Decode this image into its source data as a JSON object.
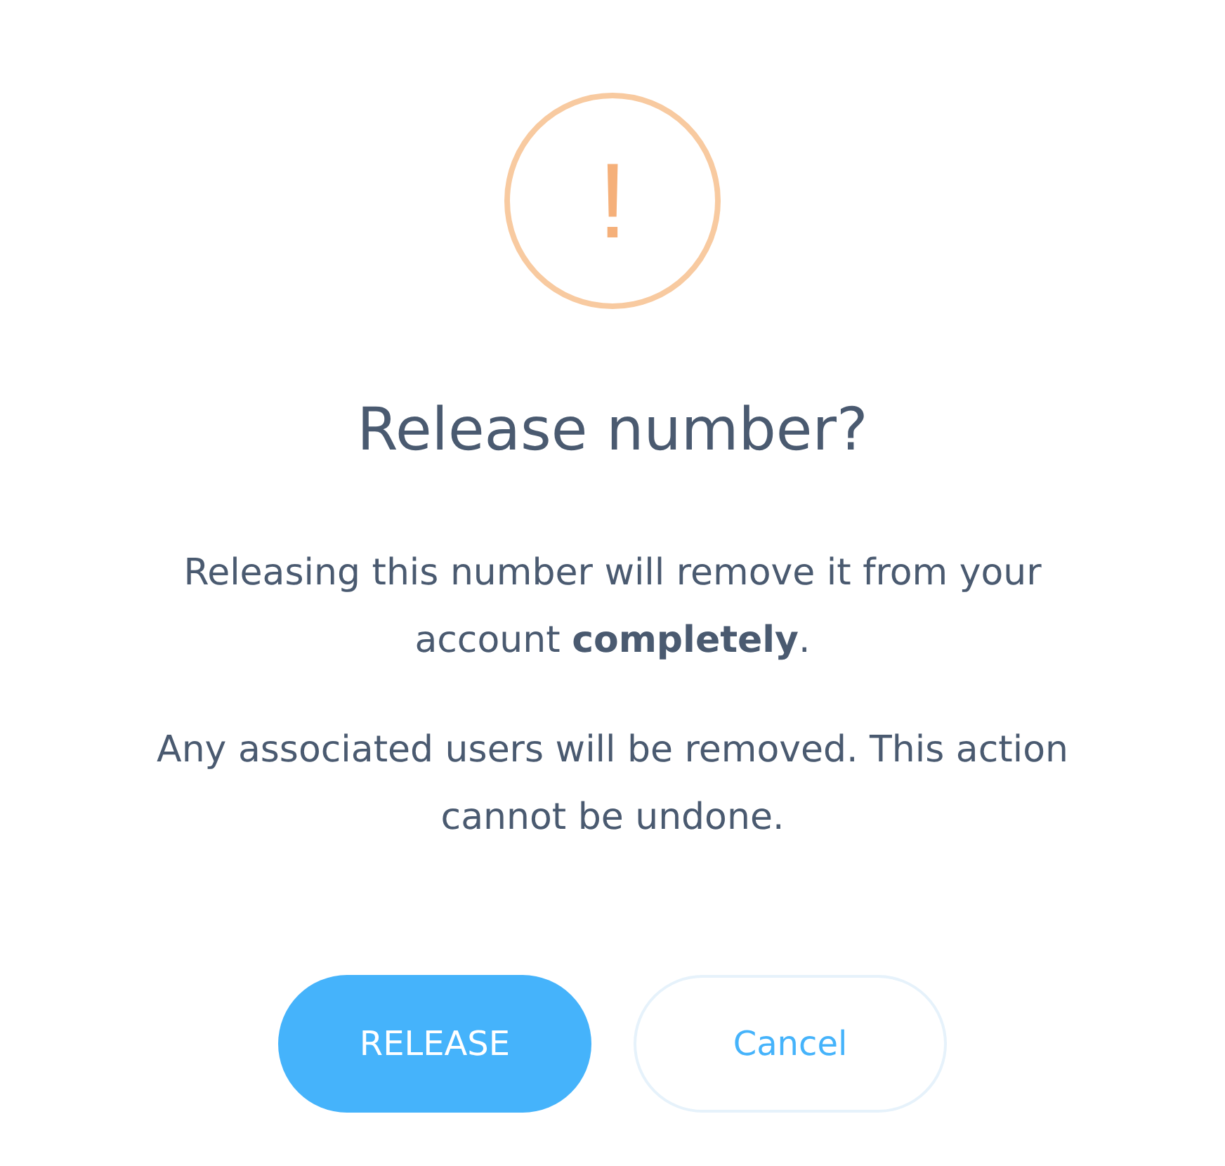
{
  "icon": {
    "glyph": "!"
  },
  "title": "Release number?",
  "paragraphs": [
    "Releasing this number will remove it from your account **completely**.",
    "Any associated users will be removed. This action cannot be undone."
  ],
  "buttons": [
    {
      "label": "RELEASE",
      "kind": "primary"
    },
    {
      "label": "Cancel",
      "kind": "secondary"
    }
  ]
}
